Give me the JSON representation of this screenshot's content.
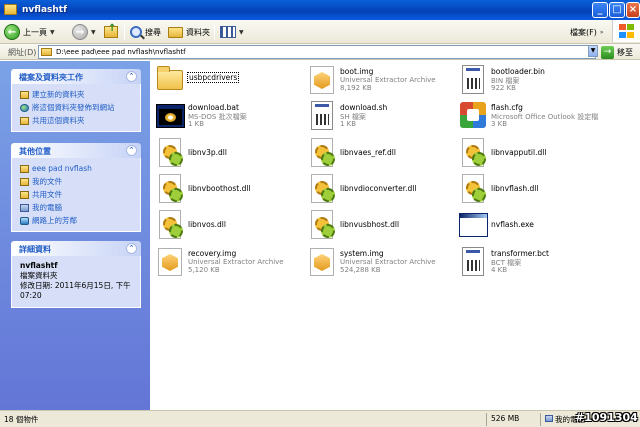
{
  "window": {
    "title": "nvflashtf"
  },
  "toolbar": {
    "back_label": "上一頁",
    "search_label": "搜尋",
    "folders_label": "資料夾",
    "tools_label": "檔案(F)"
  },
  "address": {
    "label": "網址(D)",
    "path": "D:\\eee pad\\eee pad nvflash\\nvflashtf",
    "go_label": "移至"
  },
  "tasks": {
    "title": "檔案及資料夾工作",
    "items": [
      "建立新的資料夾",
      "將這個資料夾發佈到網站",
      "共用這個資料夾"
    ]
  },
  "places": {
    "title": "其他位置",
    "items": [
      "eee pad nvflash",
      "我的文件",
      "共用文件",
      "我的電腦",
      "網路上的芳鄰"
    ]
  },
  "details": {
    "title": "詳細資料",
    "name": "nvflashtf",
    "type": "檔案資料夾",
    "modified": "修改日期: 2011年6月15日, 下午 07:20"
  },
  "files": [
    {
      "name": "usbpcdrivers",
      "type": "",
      "size": "",
      "icon": "folder-icon"
    },
    {
      "name": "boot.img",
      "type": "Universal Extractor Archive",
      "size": "8,192 KB",
      "icon": "archive-icon"
    },
    {
      "name": "bootloader.bin",
      "type": "BIN 檔案",
      "size": "922 KB",
      "icon": "document-icon"
    },
    {
      "name": "download.bat",
      "type": "MS-DOS 批次檔案",
      "size": "1 KB",
      "icon": "batch-icon"
    },
    {
      "name": "download.sh",
      "type": "SH 檔案",
      "size": "1 KB",
      "icon": "document-icon"
    },
    {
      "name": "flash.cfg",
      "type": "Microsoft Office Outlook 設定檔",
      "size": "3 KB",
      "icon": "outlook-config-icon"
    },
    {
      "name": "libnv3p.dll",
      "type": "",
      "size": "",
      "icon": "dll-icon"
    },
    {
      "name": "libnvaes_ref.dll",
      "type": "",
      "size": "",
      "icon": "dll-icon"
    },
    {
      "name": "libnvapputil.dll",
      "type": "",
      "size": "",
      "icon": "dll-icon"
    },
    {
      "name": "libnvboothost.dll",
      "type": "",
      "size": "",
      "icon": "dll-icon"
    },
    {
      "name": "libnvdioconverter.dll",
      "type": "",
      "size": "",
      "icon": "dll-icon"
    },
    {
      "name": "libnvflash.dll",
      "type": "",
      "size": "",
      "icon": "dll-icon"
    },
    {
      "name": "libnvos.dll",
      "type": "",
      "size": "",
      "icon": "dll-icon"
    },
    {
      "name": "libnvusbhost.dll",
      "type": "",
      "size": "",
      "icon": "dll-icon"
    },
    {
      "name": "nvflash.exe",
      "type": "",
      "size": "",
      "icon": "executable-icon"
    },
    {
      "name": "recovery.img",
      "type": "Universal Extractor Archive",
      "size": "5,120 KB",
      "icon": "archive-icon"
    },
    {
      "name": "system.img",
      "type": "Universal Extractor Archive",
      "size": "524,288 KB",
      "icon": "archive-icon"
    },
    {
      "name": "transformer.bct",
      "type": "BCT 檔案",
      "size": "4 KB",
      "icon": "document-icon"
    }
  ],
  "status": {
    "count": "18 個物件",
    "size": "526 MB",
    "location": "我的電腦"
  },
  "watermark": "#1091304"
}
